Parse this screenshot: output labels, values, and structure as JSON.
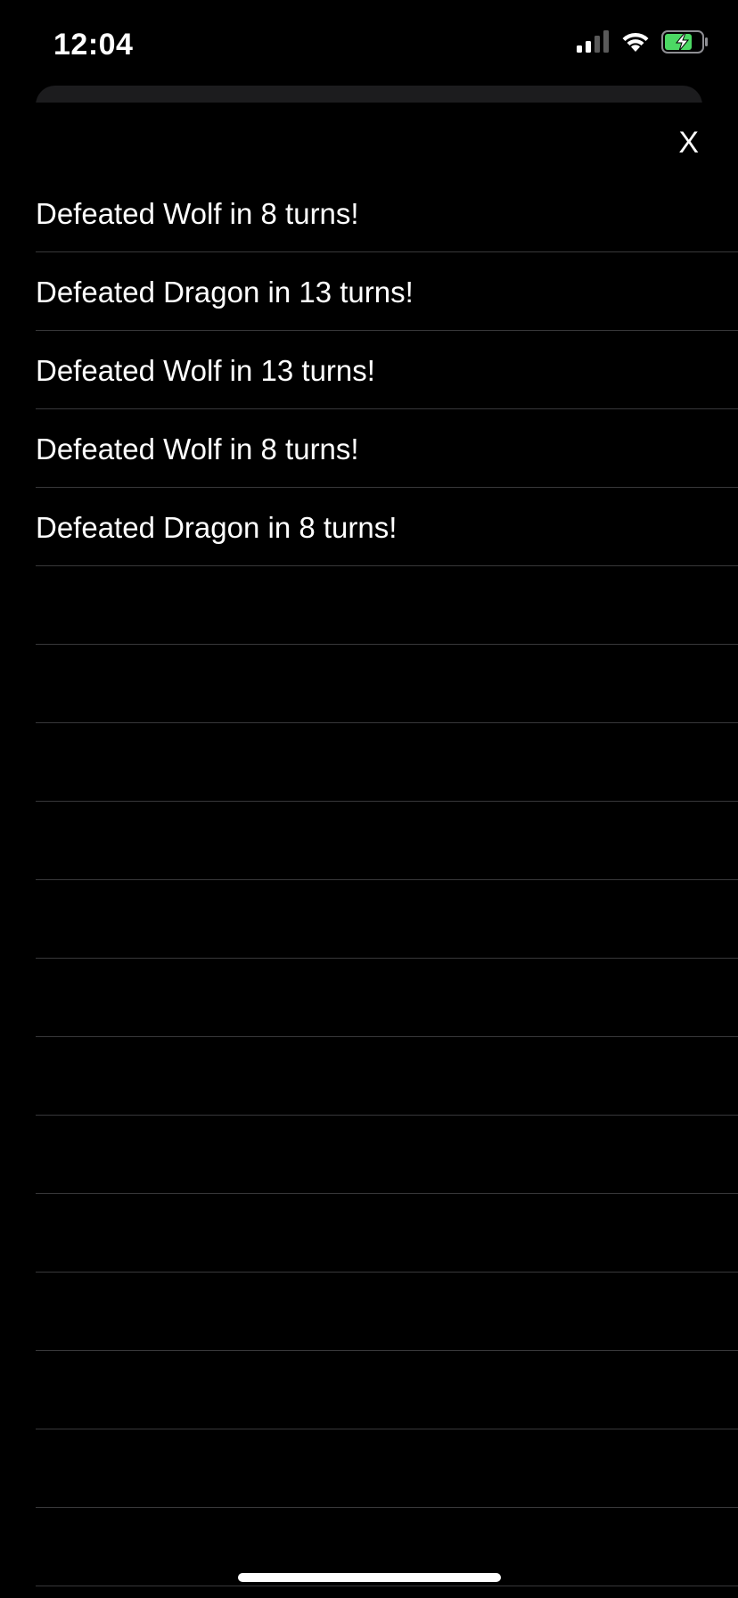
{
  "status_bar": {
    "time": "12:04",
    "signal_icon": "cellular-signal-icon",
    "wifi_icon": "wifi-icon",
    "battery_icon": "battery-charging-icon",
    "battery_color": "#4cd964"
  },
  "sheet": {
    "close_label": "X"
  },
  "battle_log": {
    "entries": [
      "Defeated Wolf in 8 turns!",
      "Defeated Dragon in 13 turns!",
      "Defeated Wolf in 13 turns!",
      "Defeated Wolf in 8 turns!",
      "Defeated Dragon in 8 turns!",
      "",
      "",
      "",
      "",
      "",
      "",
      "",
      "",
      "",
      "",
      "",
      "",
      ""
    ]
  },
  "colors": {
    "background": "#000000",
    "separator": "#38383a",
    "text": "#ffffff",
    "sheet_peek": "#1c1c1e"
  }
}
